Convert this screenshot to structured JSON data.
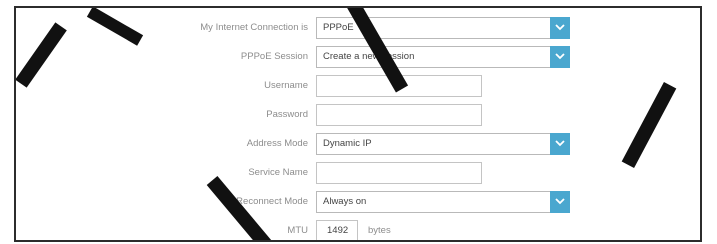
{
  "form": {
    "connection_type": {
      "label": "My Internet Connection is",
      "value": "PPPoE"
    },
    "session": {
      "label": "PPPoE Session",
      "value": "Create a new session"
    },
    "username": {
      "label": "Username",
      "value": ""
    },
    "password": {
      "label": "Password",
      "value": ""
    },
    "address_mode": {
      "label": "Address Mode",
      "value": "Dynamic IP"
    },
    "service_name": {
      "label": "Service Name",
      "value": ""
    },
    "reconnect_mode": {
      "label": "Reconnect Mode",
      "value": "Always on"
    },
    "mtu": {
      "label": "MTU",
      "value": "1492",
      "unit": "bytes"
    }
  },
  "colors": {
    "dropdown_accent": "#4aa7cf",
    "label_text": "#8d8d8d",
    "border": "#b9b9b9"
  },
  "icons": {
    "dropdown": "chevron-down-icon"
  }
}
